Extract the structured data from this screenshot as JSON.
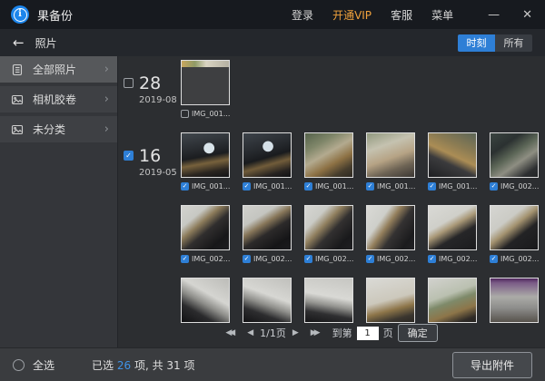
{
  "colors": {
    "accent_blue": "#2e7fd6",
    "vip_orange": "#f0a23c",
    "count_blue": "#3f93e8"
  },
  "titlebar": {
    "app_name": "果备份",
    "links": [
      {
        "label": "登录",
        "highlight": false
      },
      {
        "label": "开通VIP",
        "highlight": true
      },
      {
        "label": "客服",
        "highlight": false
      },
      {
        "label": "菜单",
        "highlight": false
      }
    ],
    "minimize": "—",
    "close": "✕"
  },
  "toolbar": {
    "back_label": "照片",
    "toggle": [
      {
        "label": "时刻",
        "active": true
      },
      {
        "label": "所有",
        "active": false
      }
    ]
  },
  "sidebar": {
    "items": [
      {
        "label": "全部照片",
        "icon": "list-icon",
        "selected": true
      },
      {
        "label": "相机胶卷",
        "icon": "photo-icon",
        "selected": false
      },
      {
        "label": "未分类",
        "icon": "photo-icon",
        "selected": false
      }
    ]
  },
  "grid": {
    "groups": [
      {
        "day": "28",
        "date": "2019-08",
        "checked": false,
        "photos": [
          {
            "label": "IMG_001...",
            "checked": false,
            "variant": "v-shot",
            "labeled": true
          }
        ]
      },
      {
        "day": "16",
        "date": "2019-05",
        "checked": true,
        "photos": [
          {
            "label": "IMG_001...",
            "checked": true,
            "variant": "v-d1",
            "labeled": true
          },
          {
            "label": "IMG_001...",
            "checked": true,
            "variant": "v-d2",
            "labeled": true
          },
          {
            "label": "IMG_001...",
            "checked": true,
            "variant": "v-d3",
            "labeled": true
          },
          {
            "label": "IMG_001...",
            "checked": true,
            "variant": "v-d4",
            "labeled": true
          },
          {
            "label": "IMG_001...",
            "checked": true,
            "variant": "v-d5",
            "labeled": true
          },
          {
            "label": "IMG_002...",
            "checked": true,
            "variant": "v-d6",
            "labeled": true
          },
          {
            "label": "IMG_002...",
            "checked": true,
            "variant": "v-c1",
            "labeled": true
          },
          {
            "label": "IMG_002...",
            "checked": true,
            "variant": "v-c2",
            "labeled": true
          },
          {
            "label": "IMG_002...",
            "checked": true,
            "variant": "v-c3",
            "labeled": true
          },
          {
            "label": "IMG_002...",
            "checked": true,
            "variant": "v-c4",
            "labeled": true
          },
          {
            "label": "IMG_002...",
            "checked": true,
            "variant": "v-c5",
            "labeled": true
          },
          {
            "label": "IMG_002...",
            "checked": true,
            "variant": "v-c6",
            "labeled": true
          },
          {
            "label": "",
            "checked": false,
            "variant": "v-e1",
            "labeled": false
          },
          {
            "label": "",
            "checked": false,
            "variant": "v-e2",
            "labeled": false
          },
          {
            "label": "",
            "checked": false,
            "variant": "v-e3",
            "labeled": false
          },
          {
            "label": "",
            "checked": false,
            "variant": "v-e4",
            "labeled": false
          },
          {
            "label": "",
            "checked": false,
            "variant": "v-e5",
            "labeled": false
          },
          {
            "label": "",
            "checked": false,
            "variant": "v-e6",
            "labeled": false
          }
        ]
      }
    ]
  },
  "pagination": {
    "first": "◀◀",
    "prev": "◀",
    "page_info": "1/1页",
    "next": "▶",
    "last": "▶▶",
    "goto_label": "到第",
    "page_value": "1",
    "page_unit": "页",
    "confirm": "确定"
  },
  "statusbar": {
    "select_all": "全选",
    "selected_prefix": "已选 ",
    "selected_count": "26",
    "selected_mid": " 项, 共 ",
    "total_count": "31",
    "total_suffix": " 项",
    "export": "导出附件"
  }
}
